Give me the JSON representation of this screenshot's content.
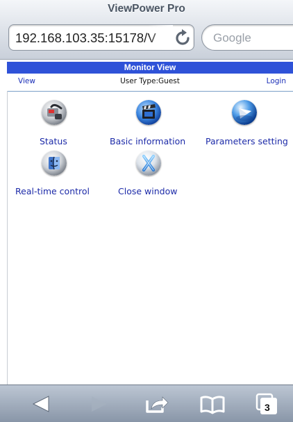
{
  "browser": {
    "page_title": "ViewPower Pro",
    "url": "192.168.103.35:15178/V",
    "search_placeholder": "Google",
    "tab_count": "3"
  },
  "header": {
    "banner_title": "Monitor View",
    "view_link": "View",
    "user_type_label": "User Type:",
    "user_type_value": "Guest",
    "login_link": "Login"
  },
  "menu": {
    "items": [
      {
        "label": "Status",
        "icon": "status-phone-icon"
      },
      {
        "label": "Basic information",
        "icon": "film-clapper-icon"
      },
      {
        "label": "Parameters setting",
        "icon": "globe-settings-icon"
      },
      {
        "label": "Real-time control",
        "icon": "finder-face-icon"
      },
      {
        "label": "Close window",
        "icon": "x-close-icon"
      }
    ]
  },
  "toolbar": {
    "buttons": [
      "back",
      "forward",
      "share",
      "bookmarks",
      "tabs"
    ]
  },
  "colors": {
    "banner": "#2f52d8",
    "link": "#1b2fb8",
    "menu_label": "#1c2aa8"
  }
}
